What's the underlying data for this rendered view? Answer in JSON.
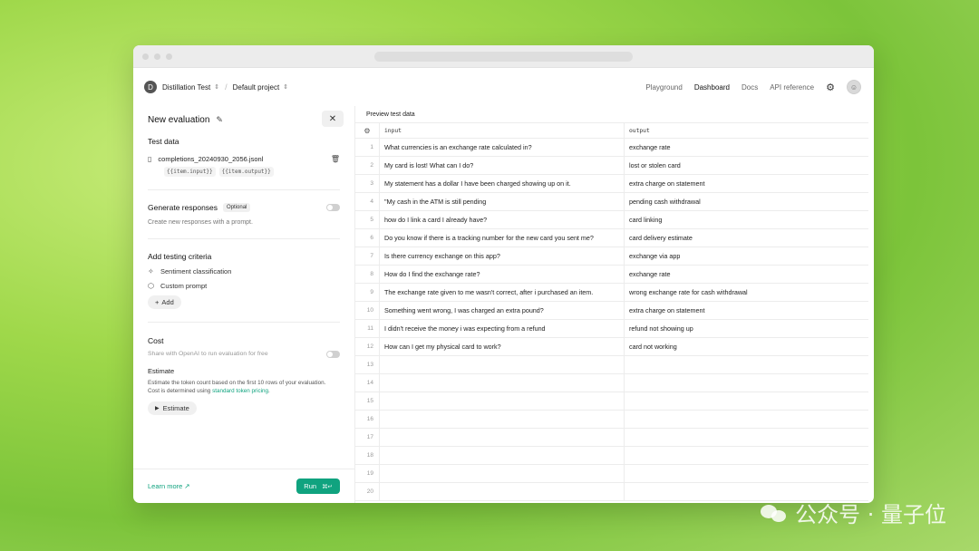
{
  "topbar": {
    "org_initial": "D",
    "org_name": "Distillation Test",
    "project_name": "Default project",
    "nav": [
      "Playground",
      "Dashboard",
      "Docs",
      "API reference"
    ]
  },
  "panel": {
    "title": "New evaluation",
    "test_data": {
      "title": "Test data",
      "file_name": "completions_20240930_2056.jsonl",
      "tags": [
        "{{item.input}}",
        "{{item.output}}"
      ]
    },
    "generate": {
      "title": "Generate responses",
      "badge": "Optional",
      "desc": "Create new responses with a prompt."
    },
    "criteria": {
      "title": "Add testing criteria",
      "items": [
        "Sentiment classification",
        "Custom prompt"
      ],
      "add_label": "Add"
    },
    "cost": {
      "title": "Cost",
      "share_label": "Share with OpenAI to run evaluation for free",
      "estimate_title": "Estimate",
      "estimate_desc_1": "Estimate the token count based on the first 10 rows of your evaluation.",
      "estimate_desc_2": "Cost is determined using",
      "estimate_link": "standard token pricing",
      "estimate_period": ".",
      "estimate_button": "Estimate"
    },
    "footer": {
      "learn_more": "Learn more ↗",
      "run_label": "Run",
      "run_shortcut": "⌘↵"
    }
  },
  "preview": {
    "title": "Preview test data",
    "columns": [
      "input",
      "output"
    ],
    "rows": [
      {
        "idx": "1",
        "input": "What currencies is an exchange rate calculated in?",
        "output": "exchange rate"
      },
      {
        "idx": "2",
        "input": "My card is lost! What can I do?",
        "output": "lost or stolen card"
      },
      {
        "idx": "3",
        "input": "My statement has a dollar I have been charged showing up on it.",
        "output": "extra charge on statement"
      },
      {
        "idx": "4",
        "input": "\"My cash in the ATM is still pending",
        "output": "pending cash withdrawal"
      },
      {
        "idx": "5",
        "input": "how do I link a card I already have?",
        "output": "card linking"
      },
      {
        "idx": "6",
        "input": "Do you know if there is a tracking number for the new card you sent me?",
        "output": "card delivery estimate"
      },
      {
        "idx": "7",
        "input": "Is there currency exchange on this app?",
        "output": "exchange via app"
      },
      {
        "idx": "8",
        "input": "How do I find the exchange rate?",
        "output": "exchange rate"
      },
      {
        "idx": "9",
        "input": "The exchange rate given to me wasn't correct, after i purchased an item.",
        "output": "wrong exchange rate for cash withdrawal"
      },
      {
        "idx": "10",
        "input": "Something went wrong, I was charged an extra pound?",
        "output": "extra charge on statement"
      },
      {
        "idx": "11",
        "input": "I didn't receive the money i was expecting from a refund",
        "output": "refund not showing up"
      },
      {
        "idx": "12",
        "input": "How can I get my physical card to work?",
        "output": "card not working"
      },
      {
        "idx": "13",
        "input": "",
        "output": ""
      },
      {
        "idx": "14",
        "input": "",
        "output": ""
      },
      {
        "idx": "15",
        "input": "",
        "output": ""
      },
      {
        "idx": "16",
        "input": "",
        "output": ""
      },
      {
        "idx": "17",
        "input": "",
        "output": ""
      },
      {
        "idx": "18",
        "input": "",
        "output": ""
      },
      {
        "idx": "19",
        "input": "",
        "output": ""
      },
      {
        "idx": "20",
        "input": "",
        "output": ""
      }
    ]
  },
  "watermark": "公众号 · 量子位",
  "icons": {
    "gear": "gear-icon",
    "avatar": "avatar",
    "pencil": "pencil-icon",
    "close": "close-icon",
    "file": "file-icon",
    "trash": "trash-icon",
    "sentiment": "sparkle-icon",
    "custom": "cube-icon"
  },
  "colors": {
    "accent": "#10a37f",
    "background": "#9fd84a"
  }
}
